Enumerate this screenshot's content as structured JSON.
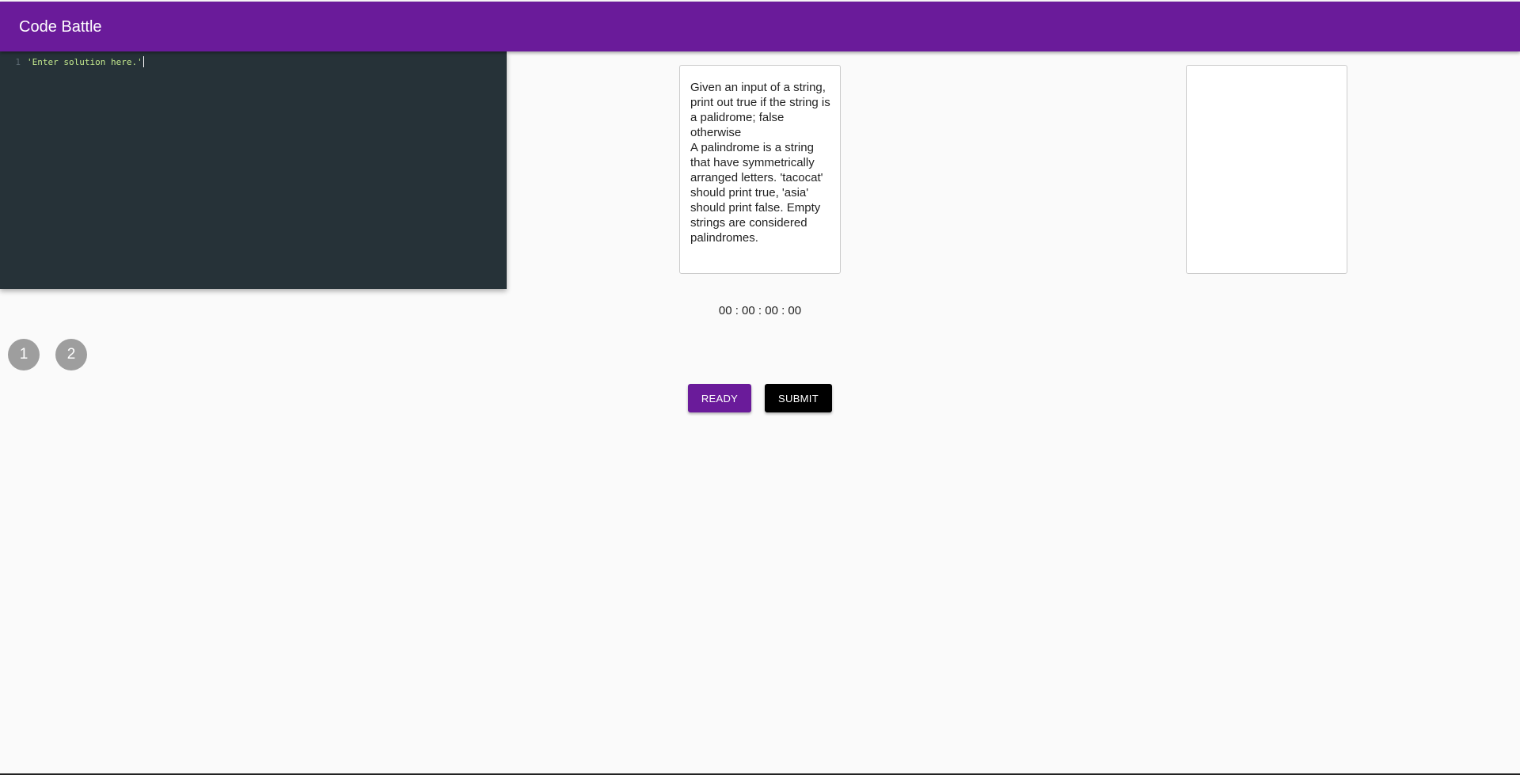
{
  "app": {
    "title": "Code Battle"
  },
  "editor": {
    "line_number": "1",
    "code": "'Enter solution here.'"
  },
  "problem": {
    "paragraphs": [
      "Given an input of a string, print out true if the string is a palidrome; false otherwise",
      "A palindrome is a string that have symmetrically arranged letters. 'tacocat' should print true, 'asia' should print false. Empty strings are considered palindromes."
    ]
  },
  "output": {
    "content": ""
  },
  "timer": {
    "value": "00 : 00 : 00 : 00"
  },
  "players": [
    {
      "label": "1"
    },
    {
      "label": "2"
    }
  ],
  "buttons": {
    "ready_label": "READY",
    "submit_label": "SUBMIT"
  },
  "colors": {
    "primary": "#6a1b9a",
    "editor_bg": "#263238",
    "code_string": "#c3e88d",
    "player_avatar": "#9e9e9e",
    "submit_bg": "#000000"
  }
}
